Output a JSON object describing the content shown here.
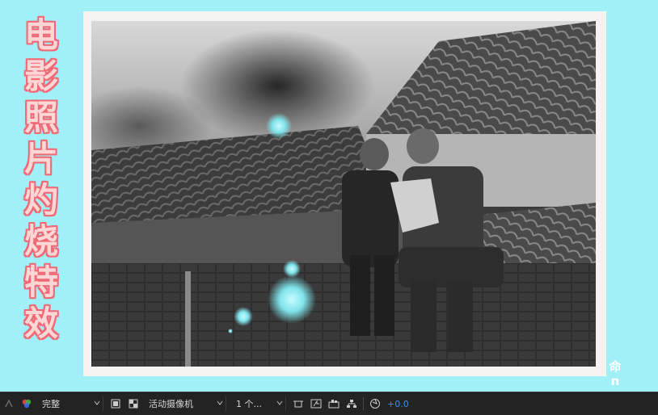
{
  "title": {
    "chars": [
      "电",
      "影",
      "照",
      "片",
      "灼",
      "烧",
      "特",
      "效"
    ]
  },
  "photo": {
    "description_icon": "black-and-white-photo-icon"
  },
  "corner": {
    "glyphs": [
      "命",
      "n"
    ]
  },
  "toolbar": {
    "resolution": "完整",
    "camera": "活动摄像机",
    "views": "1 个...",
    "exposure": "+0.0"
  },
  "colors": {
    "background": "#a2f0f7",
    "title_fill": "#ffd6d6",
    "title_stroke": "#f06a76",
    "burn_glow": "#7fe3ea",
    "exposure": "#3a8ff5"
  }
}
